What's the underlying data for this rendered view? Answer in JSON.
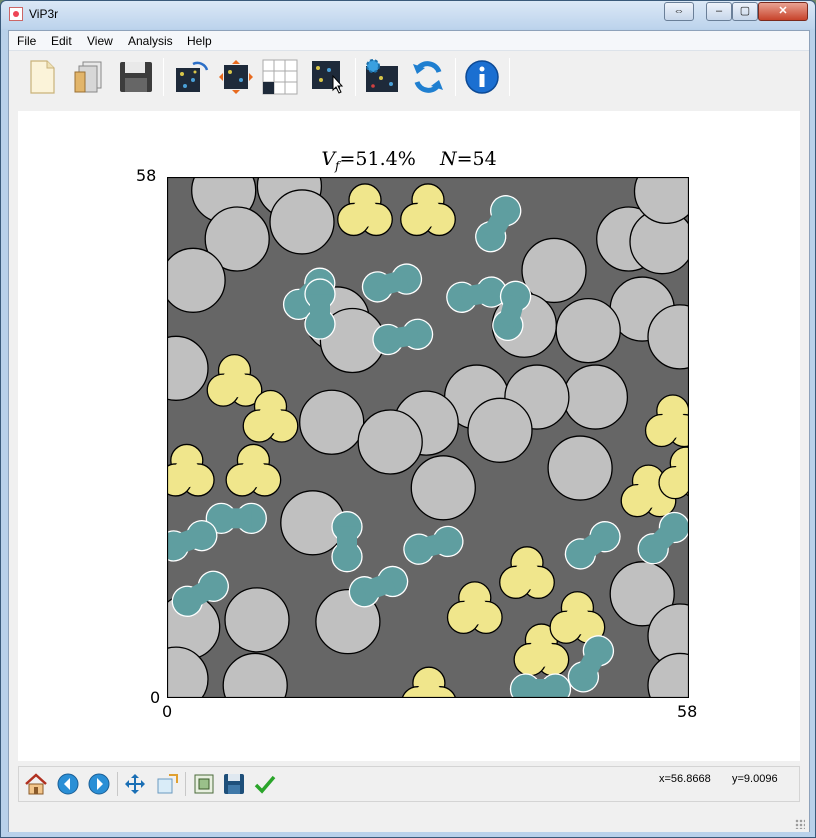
{
  "window": {
    "title": "ViP3r",
    "icon": "app-icon",
    "buttons": {
      "restore_extra": "⇔",
      "minimize": "–",
      "maximize": "▢",
      "close": "✕"
    }
  },
  "menu": [
    "File",
    "Edit",
    "View",
    "Analysis",
    "Help"
  ],
  "toolbar": [
    {
      "name": "new-file-icon"
    },
    {
      "name": "open-folder-icon"
    },
    {
      "name": "save-icon"
    },
    {
      "name": "regenerate-microstructure-icon"
    },
    {
      "name": "periodic-boundary-icon"
    },
    {
      "name": "grid-icon"
    },
    {
      "name": "select-particle-icon"
    },
    {
      "name": "settings-microstructure-icon"
    },
    {
      "name": "refresh-icon"
    },
    {
      "name": "info-icon"
    }
  ],
  "plot": {
    "title_vf_label": "V",
    "title_vf_sub": "f",
    "title_vf_value": "=51.4%",
    "title_n_label": "N",
    "title_n_value": "=54",
    "y_max_label": "58",
    "y_min_label": "0",
    "x_min_label": "0",
    "x_max_label": "58",
    "colors": {
      "matrix": "#666666",
      "circle": "#c0c0c0",
      "tri": "#f0e68c",
      "peanut": "#5f9ea0"
    }
  },
  "chart_data": {
    "type": "scatter",
    "xlim": [
      0,
      58
    ],
    "ylim": [
      0,
      58
    ],
    "grid": false,
    "circles": [
      [
        6.3,
        56.5
      ],
      [
        13.6,
        57.0
      ],
      [
        15.0,
        53.0
      ],
      [
        7.8,
        51.1
      ],
      [
        2.9,
        46.5
      ],
      [
        18.9,
        42.2
      ],
      [
        20.6,
        39.8
      ],
      [
        1.0,
        36.7
      ],
      [
        43.0,
        47.6
      ],
      [
        51.3,
        51.1
      ],
      [
        55.0,
        50.8
      ],
      [
        52.8,
        43.3
      ],
      [
        57.0,
        40.2
      ],
      [
        39.7,
        41.5
      ],
      [
        46.8,
        40.9
      ],
      [
        47.6,
        33.5
      ],
      [
        34.4,
        33.5
      ],
      [
        41.1,
        33.5
      ],
      [
        28.8,
        30.6
      ],
      [
        37.0,
        29.8
      ],
      [
        45.9,
        25.6
      ],
      [
        18.3,
        30.7
      ],
      [
        24.8,
        28.5
      ],
      [
        30.7,
        23.4
      ],
      [
        16.2,
        19.5
      ],
      [
        2.3,
        7.9
      ],
      [
        10.0,
        8.7
      ],
      [
        20.1,
        8.5
      ],
      [
        52.8,
        11.6
      ],
      [
        57.0,
        6.9
      ],
      [
        1.0,
        2.1
      ],
      [
        9.8,
        1.4
      ],
      [
        57.0,
        1.4
      ],
      [
        55.5,
        56.4
      ]
    ],
    "tris": [
      [
        22.0,
        54.0
      ],
      [
        29.0,
        54.0
      ],
      [
        7.5,
        35.0
      ],
      [
        11.5,
        31.0
      ],
      [
        2.2,
        25.0
      ],
      [
        9.6,
        25.0
      ],
      [
        56.2,
        30.5
      ],
      [
        53.5,
        22.7
      ],
      [
        57.7,
        24.7
      ],
      [
        34.2,
        9.7
      ],
      [
        40.0,
        13.6
      ],
      [
        41.6,
        5.0
      ],
      [
        45.6,
        8.6
      ],
      [
        29.1,
        0.2
      ]
    ],
    "peanuts": [
      [
        36.8,
        52.8,
        60
      ],
      [
        15.8,
        45.0,
        45
      ],
      [
        25.0,
        46.2,
        15
      ],
      [
        34.4,
        44.9,
        10
      ],
      [
        17.0,
        43.3,
        90
      ],
      [
        38.3,
        43.1,
        75
      ],
      [
        26.2,
        40.2,
        10
      ],
      [
        7.7,
        20.0,
        0
      ],
      [
        2.3,
        17.5,
        20
      ],
      [
        20.0,
        17.4,
        90
      ],
      [
        29.6,
        17.0,
        15
      ],
      [
        3.7,
        11.6,
        30
      ],
      [
        23.5,
        12.4,
        20
      ],
      [
        47.3,
        17.0,
        35
      ],
      [
        55.2,
        17.8,
        45
      ],
      [
        47.1,
        3.8,
        60
      ],
      [
        41.5,
        1.0,
        0
      ]
    ]
  },
  "nav": {
    "icons": [
      "home-icon",
      "back-icon",
      "forward-icon",
      "pan-icon",
      "zoom-icon",
      "configure-subplots-icon",
      "save-figure-icon",
      "apply-icon"
    ],
    "x_readout": "x=56.8668",
    "y_readout": "y=9.0096"
  }
}
